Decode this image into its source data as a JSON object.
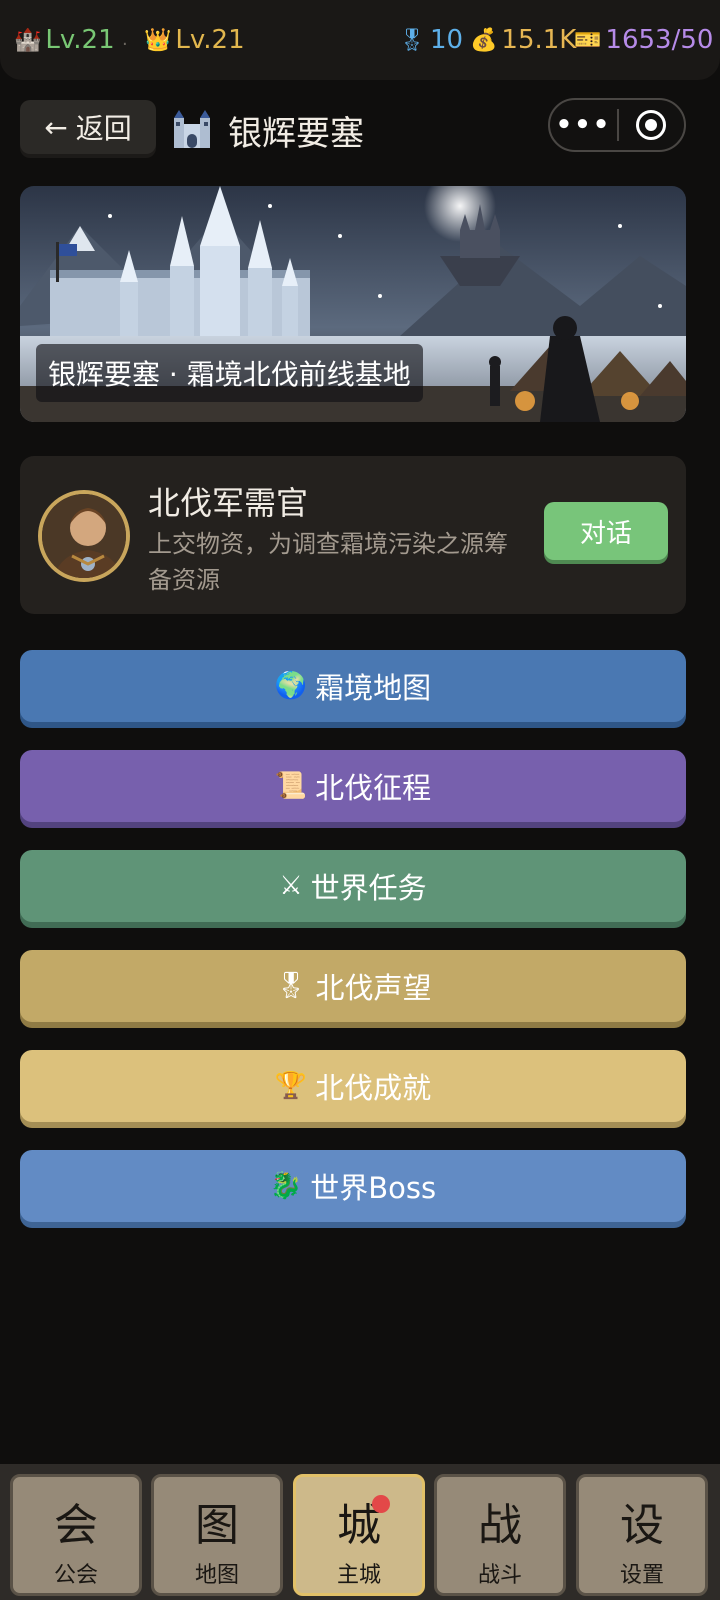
{
  "status_bar": {
    "castle_icon": "castle-icon",
    "castle_level": "Lv.21",
    "separator": "·",
    "crown_icon": "crown-icon",
    "crown_level": "Lv.21",
    "medal_icon": "medal-icon",
    "medals": "10",
    "gold_icon": "money-bag-icon",
    "gold": "15.1K",
    "energy_icon": "ticket-icon",
    "energy": "1653/50"
  },
  "header": {
    "back_arrow": "←",
    "back_label": "返回",
    "title_icon": "castle-icon",
    "title": "银辉要塞",
    "more_glyph": "•••"
  },
  "banner": {
    "caption": "银辉要塞 · 霜境北伐前线基地"
  },
  "npc": {
    "name": "北伐军需官",
    "description": "上交物资，为调查霜境污染之源筹备资源",
    "talk_label": "对话"
  },
  "menu": [
    {
      "icon": "🌍",
      "icon_name": "globe-icon",
      "label": "霜境地图",
      "color": "#4a78b2"
    },
    {
      "icon": "📜",
      "icon_name": "scroll-icon",
      "label": "北伐征程",
      "color": "#7760ad"
    },
    {
      "icon": "⚔",
      "icon_name": "crossed-swords-icon",
      "label": "世界任务",
      "color": "#5f9477"
    },
    {
      "icon": "🎖",
      "icon_name": "medal-icon",
      "label": "北伐声望",
      "color": "#c2a967"
    },
    {
      "icon": "🏆",
      "icon_name": "trophy-icon",
      "label": "北伐成就",
      "color": "#dcc17c"
    },
    {
      "icon": "🐉",
      "icon_name": "dragon-icon",
      "label": "世界Boss",
      "color": "#628bc4"
    }
  ],
  "bottom_nav": [
    {
      "glyph": "会",
      "label": "公会",
      "active": false
    },
    {
      "glyph": "图",
      "label": "地图",
      "active": false
    },
    {
      "glyph": "城",
      "label": "主城",
      "active": true,
      "badge": true
    },
    {
      "glyph": "战",
      "label": "战斗",
      "active": false
    },
    {
      "glyph": "设",
      "label": "设置",
      "active": false
    }
  ]
}
